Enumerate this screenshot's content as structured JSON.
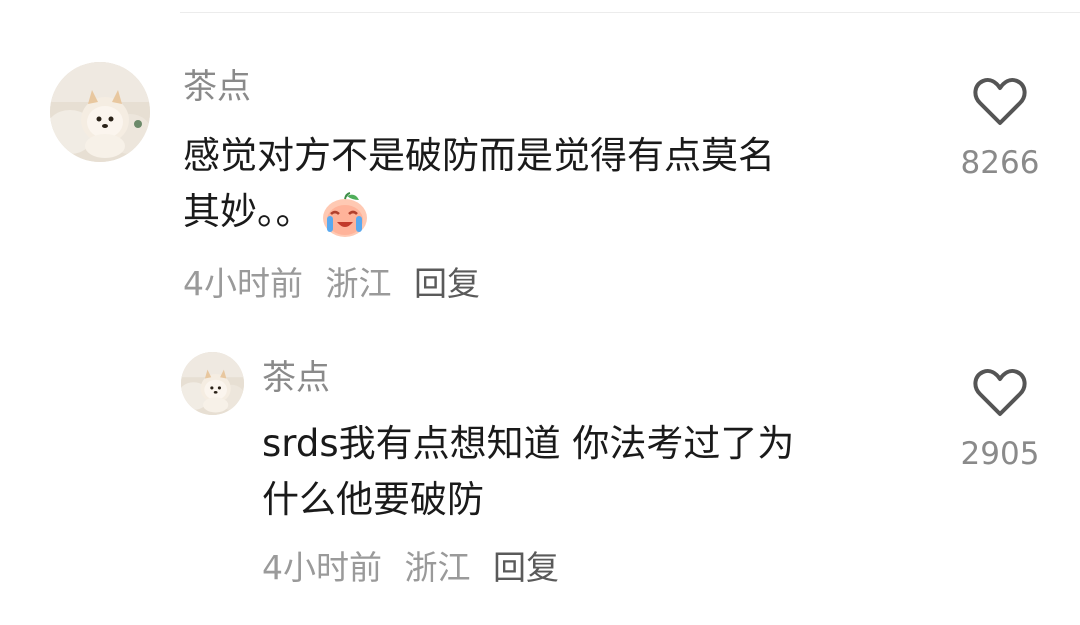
{
  "comments": [
    {
      "username": "茶点",
      "text_line1": "感觉对方不是破防而是觉得有点莫名",
      "text_line2": "其妙。。",
      "emoji": "crying-laughing-peach-emoji",
      "time": "4小时前",
      "location": "浙江",
      "reply_label": "回复",
      "likes": "8266",
      "avatar": "pomeranian-dog-avatar"
    },
    {
      "username": "茶点",
      "text_line1": "srds我有点想知道 你法考过了为",
      "text_line2": "什么他要破防",
      "time": "4小时前",
      "location": "浙江",
      "reply_label": "回复",
      "likes": "2905",
      "avatar": "pomeranian-dog-avatar"
    }
  ],
  "icons": {
    "like": "heart-outline-icon"
  },
  "colors": {
    "username": "#8a8a8a",
    "meta": "#9a9a9a",
    "text": "#1a1a1a",
    "divider": "#ececec"
  }
}
